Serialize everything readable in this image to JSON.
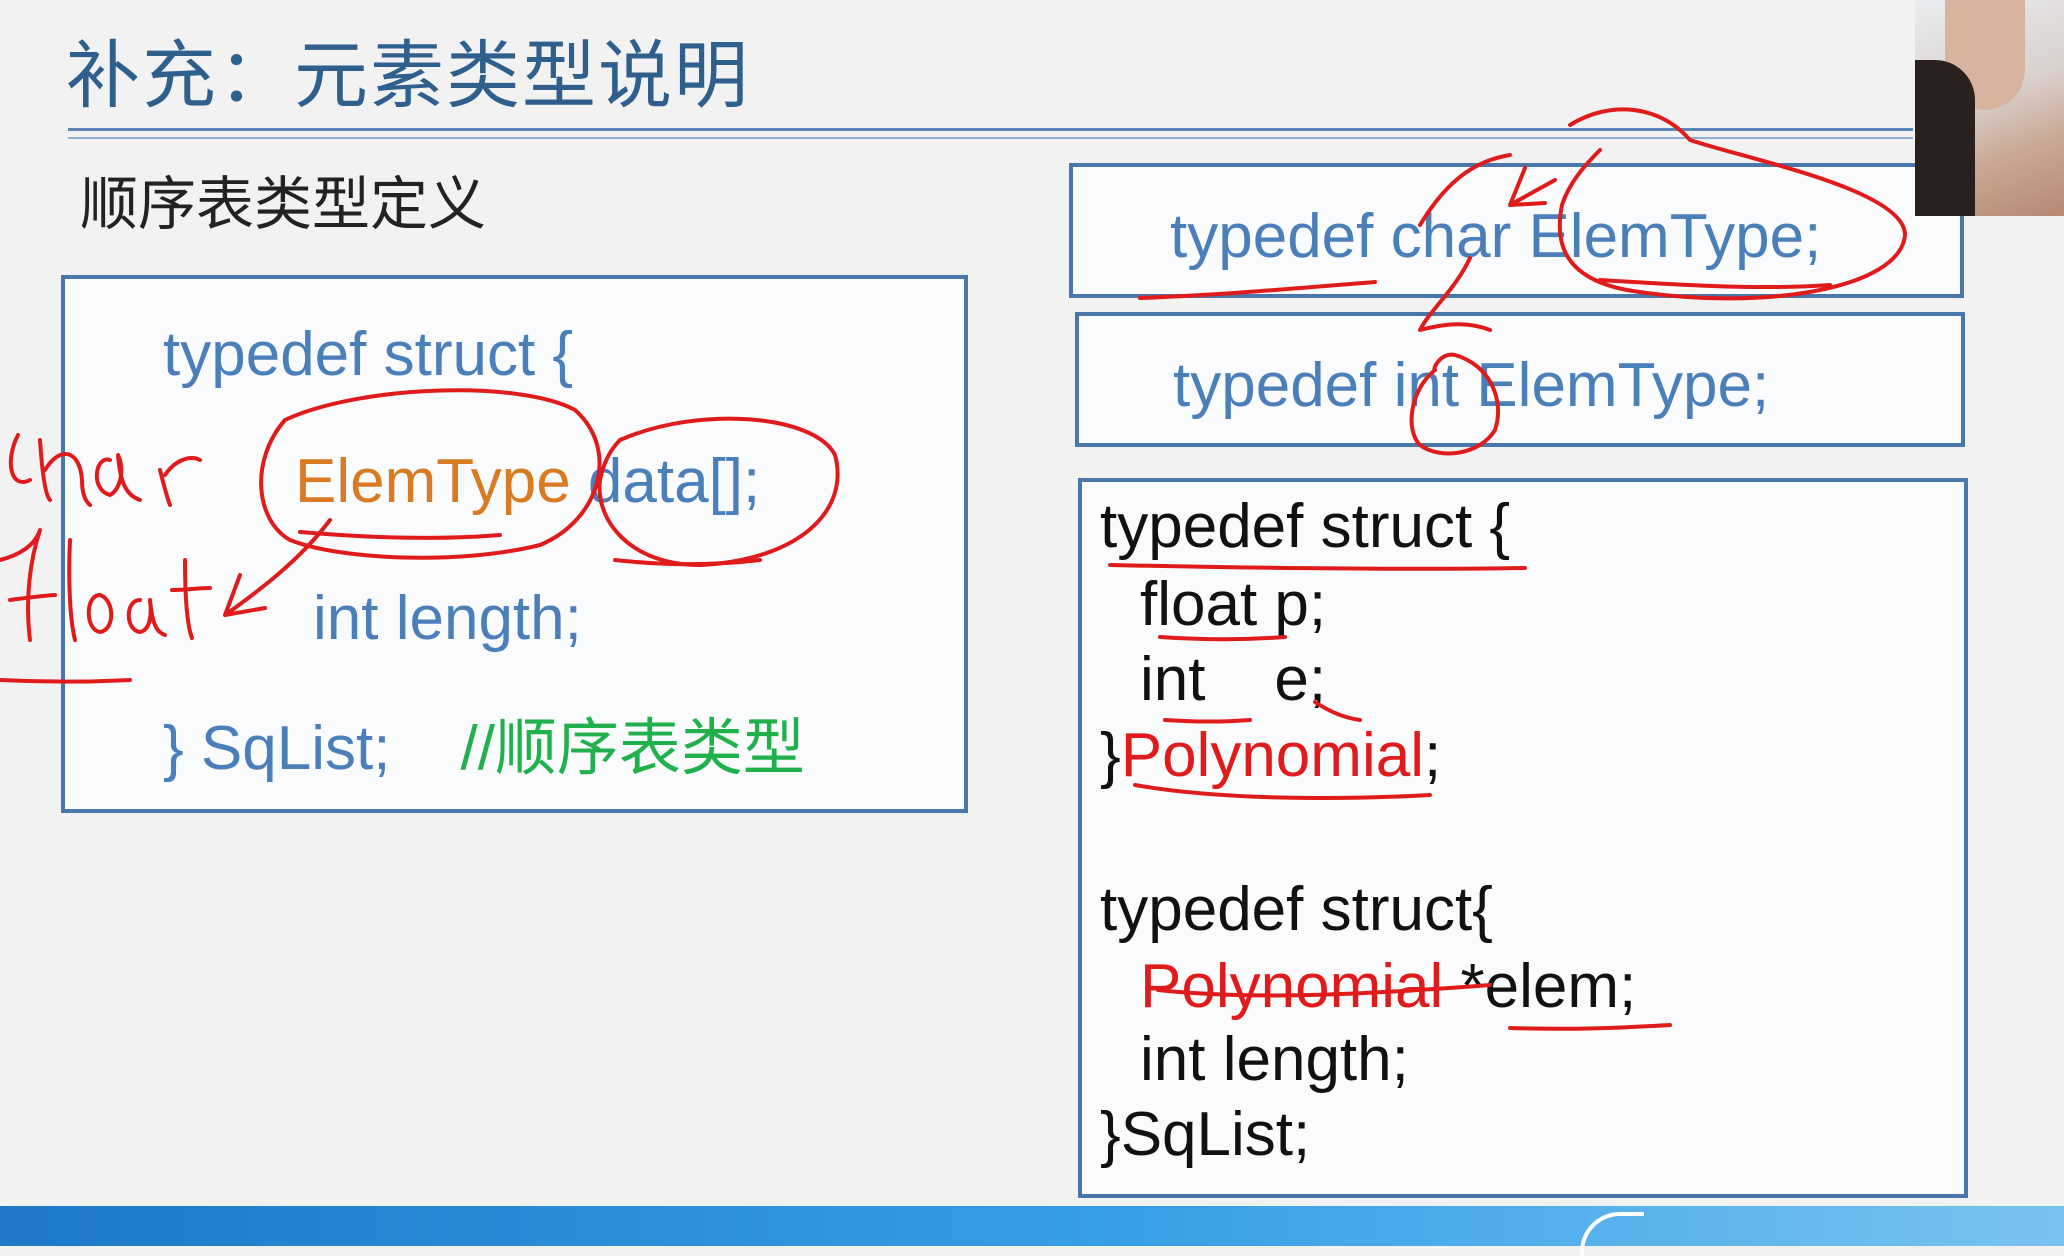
{
  "slide": {
    "title": "补充：元素类型说明",
    "section_heading": "顺序表类型定义"
  },
  "sqlist_box": {
    "line1": "typedef struct {",
    "elemtype": "ElemType",
    "data": " data[];",
    "line3": "int length;",
    "line4_code": "} SqList;",
    "line4_comment": "//顺序表类型"
  },
  "typedef_char": "typedef char ElemType;",
  "typedef_int": "typedef int ElemType;",
  "poly_box": {
    "line1": "typedef struct {",
    "line2": "float p;",
    "line3": "int    e;",
    "line4_brace": "}",
    "line4_name": "Polynomial",
    "line4_semicolon": ";",
    "line5": "typedef struct{",
    "line6_type": "Polynomial",
    "line6_var": " *elem;",
    "line7": "int length;",
    "line8": "}SqList;"
  },
  "annotations": {
    "handwriting_1": "char",
    "handwriting_2": "float"
  },
  "colors": {
    "title": "#2f5f8c",
    "code_blue": "#4b7fb9",
    "elemtype_orange": "#d97b22",
    "comment_green": "#20b14c",
    "annotation_red": "#e01b1b",
    "box_border": "#4a77aa"
  }
}
